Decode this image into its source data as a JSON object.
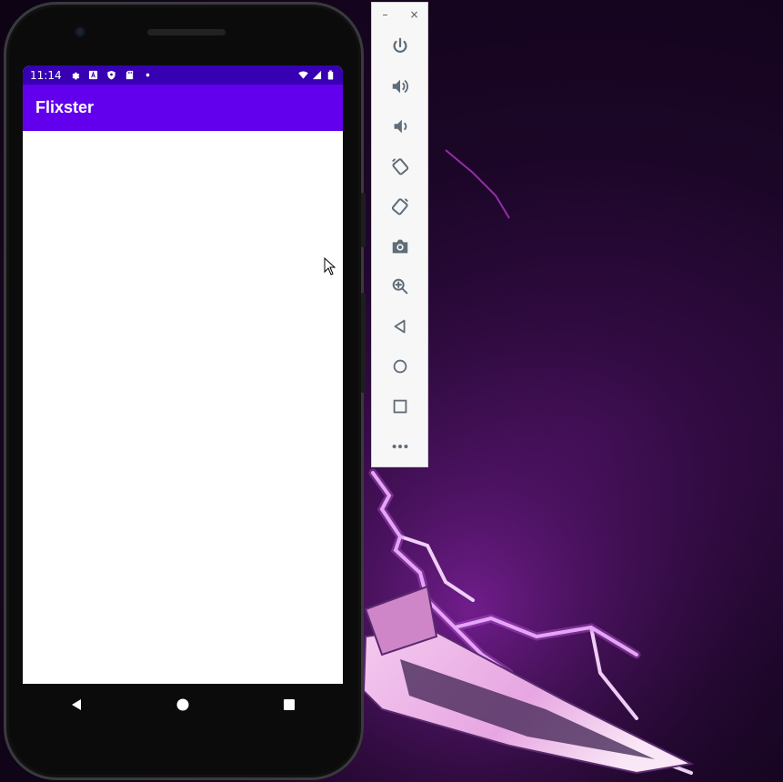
{
  "status_bar": {
    "time": "11:14",
    "left_icons": [
      "settings-icon",
      "a-notification-icon",
      "shield-icon",
      "sd-card-icon",
      "dot-icon"
    ],
    "right_icons": [
      "wifi-icon",
      "signal-icon",
      "battery-icon"
    ]
  },
  "app": {
    "title": "Flixster"
  },
  "nav_bar": {
    "buttons": [
      "back-icon",
      "home-icon",
      "recents-icon"
    ]
  },
  "toolbar": {
    "window_buttons": [
      "–",
      "×"
    ],
    "tools": [
      "power-icon",
      "volume-up-icon",
      "volume-down-icon",
      "rotate-left-icon",
      "rotate-right-icon",
      "camera-icon",
      "zoom-icon",
      "back-icon",
      "home-icon",
      "overview-icon",
      "more-icon"
    ]
  },
  "colors": {
    "status_bar": "#3700b3",
    "app_bar": "#6200ee",
    "toolbar_icon": "#5f6d7a"
  }
}
